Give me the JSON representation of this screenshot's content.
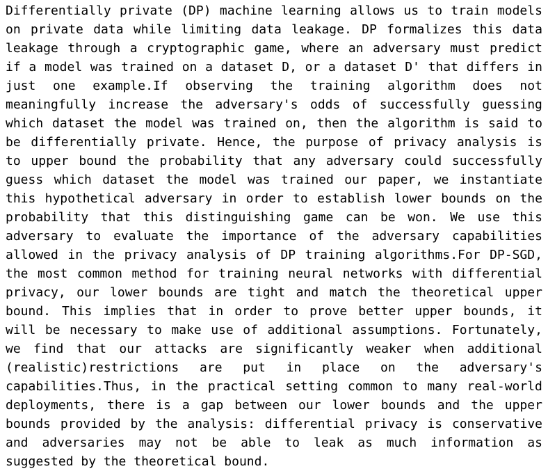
{
  "document": {
    "type": "plain-text-abstract",
    "background_color": "#ffffff",
    "text_color": "#000000",
    "alignment": "justified",
    "font_size_px": 18,
    "line_height_px": 27,
    "line_count": 22,
    "full_text": "Differentially private (DP) machine learning allows us to train models on private data while limiting data leakage. DP formalizes this data leakage through a cryptographic game, where an adversary must predict if a model was trained on a dataset D, or a dataset D' that differs in just one example.If observing the training algorithm does not meaningfully increase the adversary's odds of successfully guessing which dataset the model was trained on, then the algorithm is said to be differentially private. Hence, the purpose of privacy analysis is to upper bound the probability that any adversary could successfully guess which dataset the model was trained our paper, we instantiate this hypothetical adversary in order to establish lower bounds on the probability that this distinguishing game can be won. We use this adversary to evaluate the importance of the adversary capabilities allowed in the privacy analysis of DP training algorithms.For DP-SGD, the most common method for training neural networks with differential privacy, our lower bounds are tight and match the theoretical upper bound. This implies that in order to prove better upper bounds, it will be necessary to make use of additional assumptions. Fortunately, we find that our attacks are significantly weaker when additional (realistic)restrictions are put in place on the adversary's capabilities.Thus, in the practical setting common to many real-world deployments, there is a gap between our lower bounds and the upper bounds provided by the analysis: differential privacy is conservative and adversaries may not be able to leak as much information as suggested by the theoretical bound.",
    "lines": [
      {
        "index": 1,
        "justified": true,
        "words": [
          "Differentially",
          "private",
          "(DP)",
          "machine",
          "learning",
          "allows",
          "us",
          "to",
          "train",
          "models"
        ]
      },
      {
        "index": 2,
        "justified": true,
        "words": [
          "on",
          "private",
          "data",
          "while",
          "limiting",
          "data",
          "leakage.",
          "DP",
          "formalizes",
          "this",
          "data"
        ]
      },
      {
        "index": 3,
        "justified": true,
        "words": [
          "leakage",
          "through",
          "a",
          "cryptographic",
          "game,",
          "where",
          "an",
          "adversary",
          "must",
          "predict"
        ]
      },
      {
        "index": 4,
        "justified": true,
        "words": [
          "if",
          "a",
          "model",
          "was",
          "trained",
          "on",
          "a",
          "dataset",
          "D,",
          "or",
          "a",
          "dataset",
          "D'",
          "that",
          "differs",
          "in"
        ]
      },
      {
        "index": 5,
        "justified": true,
        "words": [
          "just",
          "one",
          "example.If",
          "observing",
          "the",
          "training",
          "algorithm",
          "does",
          "not"
        ]
      },
      {
        "index": 6,
        "justified": true,
        "words": [
          "meaningfully",
          "increase",
          "the",
          "adversary's",
          "odds",
          "of",
          "successfully",
          "guessing"
        ]
      },
      {
        "index": 7,
        "justified": true,
        "words": [
          "which",
          "dataset",
          "the",
          "model",
          "was",
          "trained",
          "on,",
          "then",
          "the",
          "algorithm",
          "is",
          "said",
          "to"
        ]
      },
      {
        "index": 8,
        "justified": true,
        "words": [
          "be",
          "differentially",
          "private.",
          "Hence,",
          "the",
          "purpose",
          "of",
          "privacy",
          "analysis",
          "is"
        ]
      },
      {
        "index": 9,
        "justified": true,
        "words": [
          "to",
          "upper",
          "bound",
          "the",
          "probability",
          "that",
          "any",
          "adversary",
          "could",
          "successfully"
        ]
      },
      {
        "index": 10,
        "justified": true,
        "words": [
          "guess",
          "which",
          "dataset",
          "the",
          "model",
          "was",
          "trained",
          "our",
          "paper,",
          "we",
          "instantiate"
        ]
      },
      {
        "index": 11,
        "justified": true,
        "words": [
          "this",
          "hypothetical",
          "adversary",
          "in",
          "order",
          "to",
          "establish",
          "lower",
          "bounds",
          "on",
          "the"
        ]
      },
      {
        "index": 12,
        "justified": true,
        "words": [
          "probability",
          "that",
          "this",
          "distinguishing",
          "game",
          "can",
          "be",
          "won.",
          "We",
          "use",
          "this"
        ]
      },
      {
        "index": 13,
        "justified": true,
        "words": [
          "adversary",
          "to",
          "evaluate",
          "the",
          "importance",
          "of",
          "the",
          "adversary",
          "capabilities"
        ]
      },
      {
        "index": 14,
        "justified": true,
        "words": [
          "allowed",
          "in",
          "the",
          "privacy",
          "analysis",
          "of",
          "DP",
          "training",
          "algorithms.For",
          "DP-SGD,"
        ]
      },
      {
        "index": 15,
        "justified": true,
        "words": [
          "the",
          "most",
          "common",
          "method",
          "for",
          "training",
          "neural",
          "networks",
          "with",
          "differential"
        ]
      },
      {
        "index": 16,
        "justified": true,
        "words": [
          "privacy,",
          "our",
          "lower",
          "bounds",
          "are",
          "tight",
          "and",
          "match",
          "the",
          "theoretical",
          "upper"
        ]
      },
      {
        "index": 17,
        "justified": true,
        "words": [
          "bound.",
          "This",
          "implies",
          "that",
          "in",
          "order",
          "to",
          "prove",
          "better",
          "upper",
          "bounds,",
          "it"
        ]
      },
      {
        "index": 18,
        "justified": true,
        "words": [
          "will",
          "be",
          "necessary",
          "to",
          "make",
          "use",
          "of",
          "additional",
          "assumptions.",
          "Fortunately,"
        ]
      },
      {
        "index": 19,
        "justified": true,
        "words": [
          "we",
          "find",
          "that",
          "our",
          "attacks",
          "are",
          "significantly",
          "weaker",
          "when",
          "additional"
        ]
      },
      {
        "index": 20,
        "justified": true,
        "words": [
          "(realistic)restrictions",
          "are",
          "put",
          "in",
          "place",
          "on",
          "the",
          "adversary's"
        ]
      },
      {
        "index": 21,
        "justified": true,
        "words": [
          "capabilities.Thus,",
          "in",
          "the",
          "practical",
          "setting",
          "common",
          "to",
          "many",
          "real-world"
        ]
      },
      {
        "index": 22,
        "justified": true,
        "words": [
          "deployments,",
          "there",
          "is",
          "a",
          "gap",
          "between",
          "our",
          "lower",
          "bounds",
          "and",
          "the",
          "upper"
        ]
      },
      {
        "index": 23,
        "justified": true,
        "words": [
          "bounds",
          "provided",
          "by",
          "the",
          "analysis:",
          "differential",
          "privacy",
          "is",
          "conservative"
        ]
      },
      {
        "index": 24,
        "justified": true,
        "words": [
          "and",
          "adversaries",
          "may",
          "not",
          "be",
          "able",
          "to",
          "leak",
          "as",
          "much",
          "information",
          "as"
        ]
      },
      {
        "index": 25,
        "justified": false,
        "words": [
          "suggested",
          "by",
          "the",
          "theoretical",
          "bound."
        ]
      }
    ]
  }
}
